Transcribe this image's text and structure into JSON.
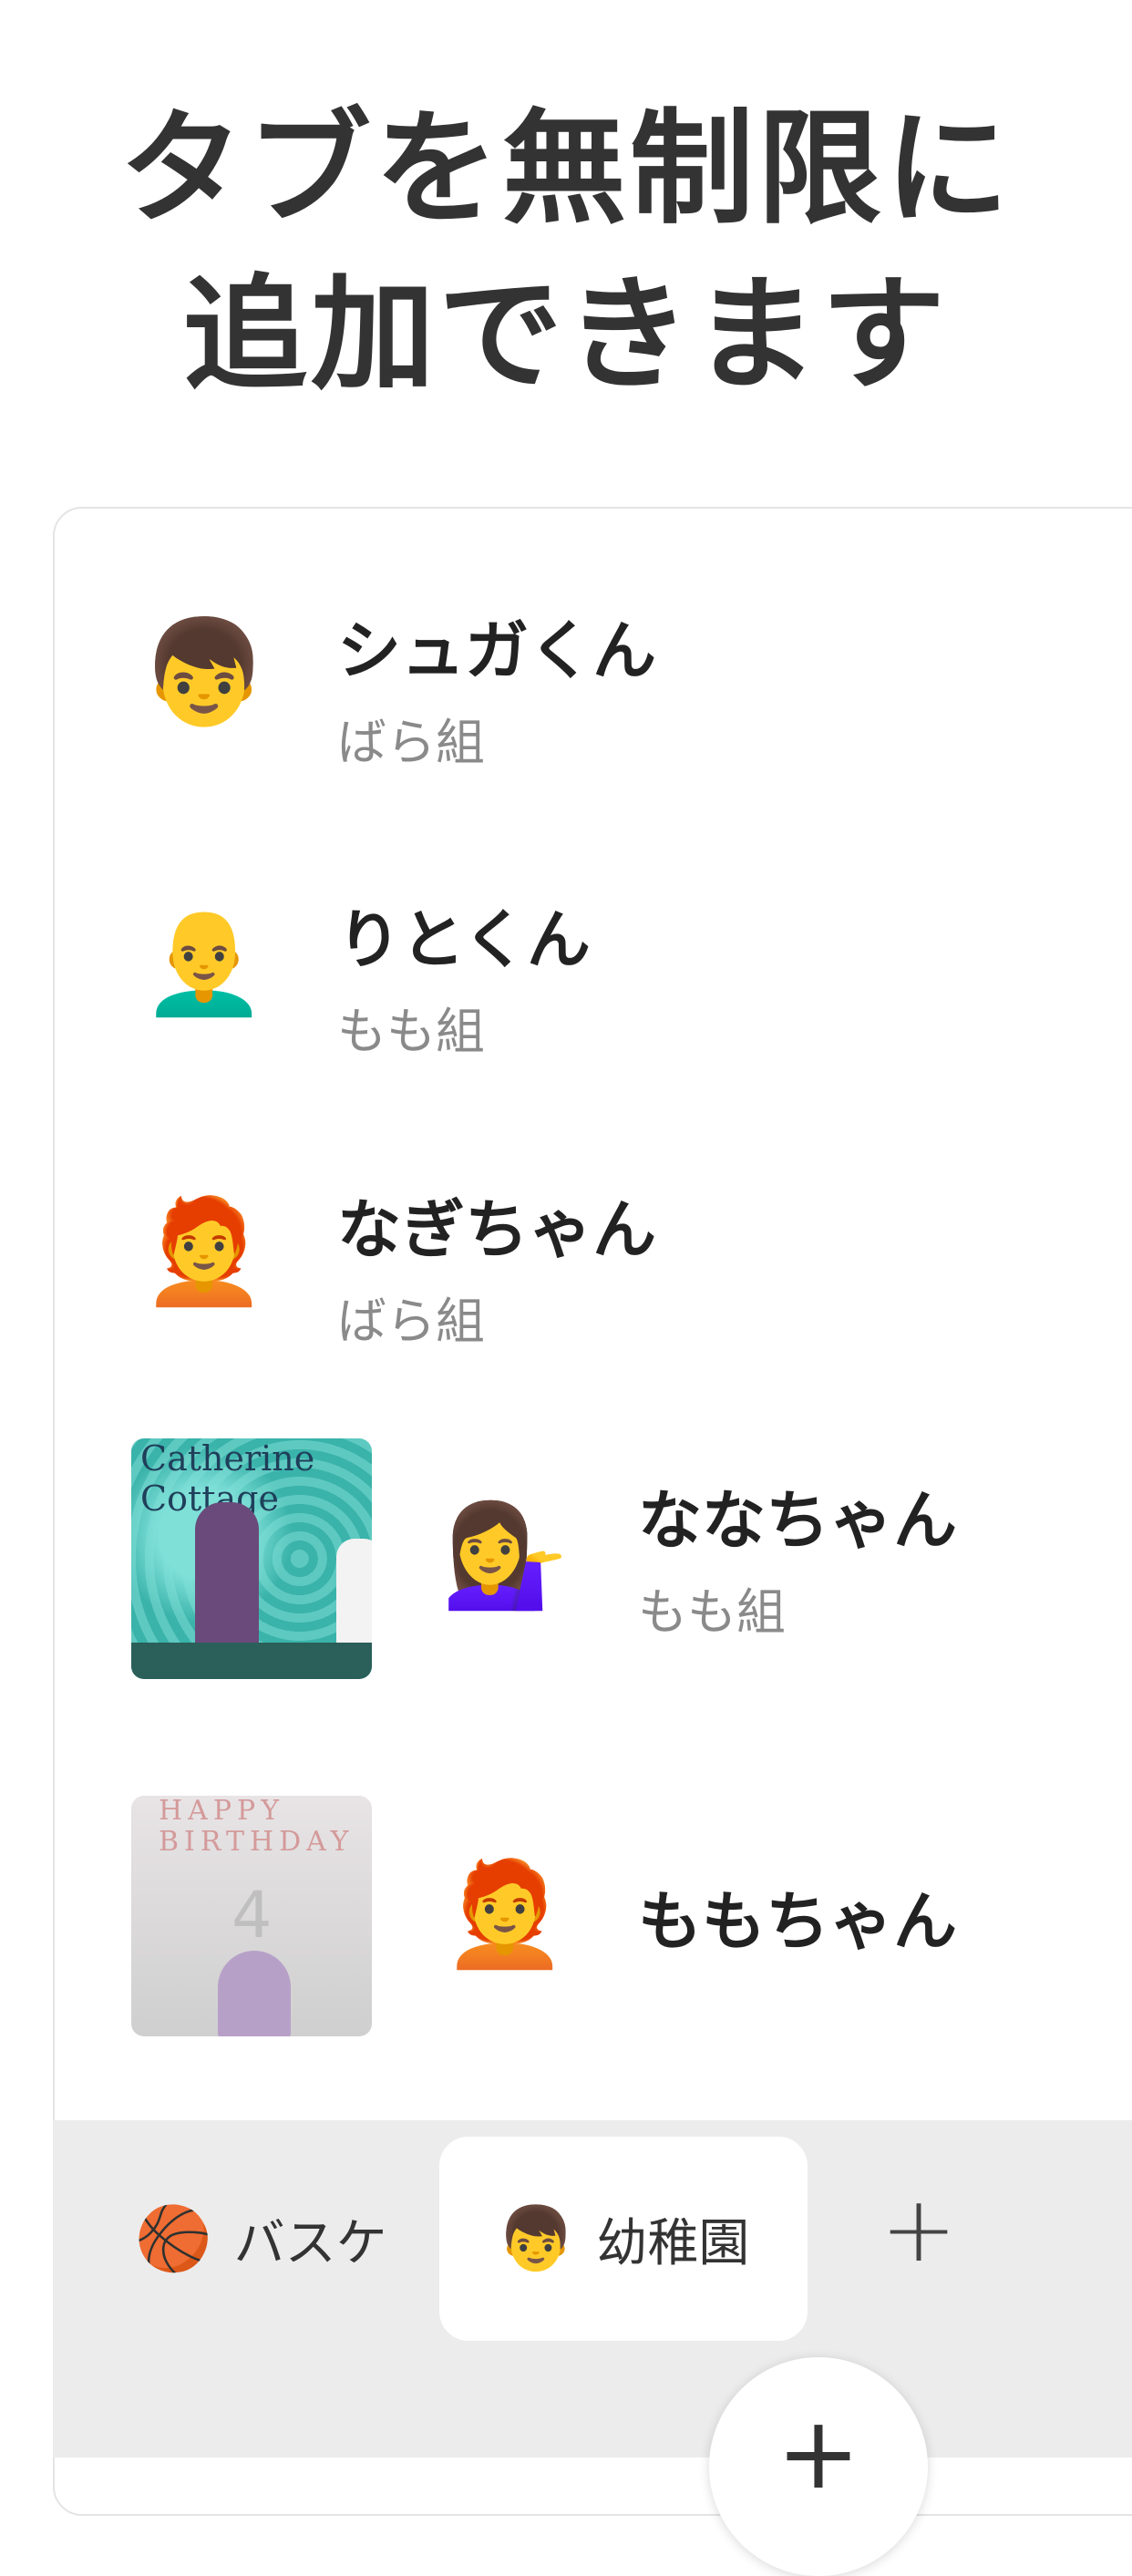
{
  "headline": {
    "line1": "タブを無制限に",
    "line2": "追加できます"
  },
  "list": [
    {
      "emoji": "👦",
      "emoji_name": "boy-emoji",
      "name": "シュガくん",
      "group": "ばら組"
    },
    {
      "emoji": "👨‍🦲",
      "emoji_name": "bald-man-emoji",
      "name": "りとくん",
      "group": "もも組"
    },
    {
      "emoji": "🧑‍🦰",
      "emoji_name": "red-hair-person-emoji",
      "name": "なぎちゃん",
      "group": "ばら組"
    },
    {
      "emoji": "💁‍♀️",
      "emoji_name": "woman-tipping-hand-emoji",
      "name": "ななちゃん",
      "group": "もも組",
      "photo_text": "Catherine\nCottage"
    },
    {
      "emoji": "🧑‍🦰",
      "emoji_name": "red-hair-person-emoji",
      "name": "ももちゃん",
      "group": "",
      "photo_text": "HAPPY BIRTHDAY",
      "photo_number": "4"
    }
  ],
  "tabs": [
    {
      "emoji": "🏀",
      "label": "バスケ"
    },
    {
      "emoji": "👦",
      "label": "幼稚園"
    }
  ],
  "add_tab_label": "+",
  "fab_label": "+"
}
